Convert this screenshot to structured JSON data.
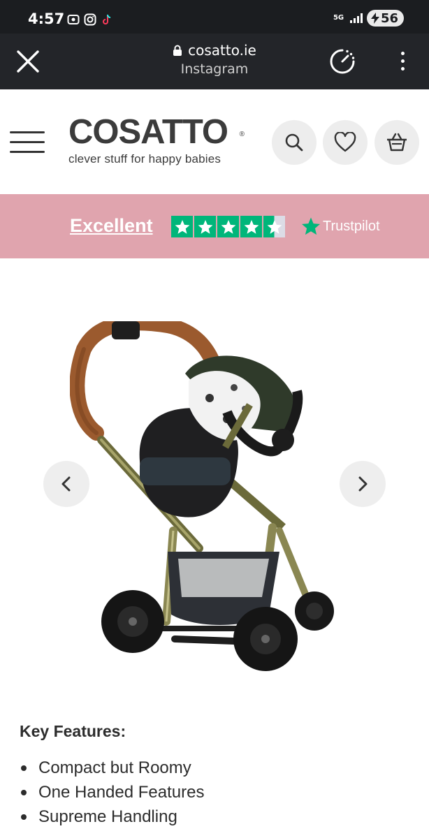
{
  "status_bar": {
    "time": "4:57",
    "network": "5G",
    "battery": "56"
  },
  "browser": {
    "url": "cosatto.ie",
    "subtitle": "Instagram"
  },
  "header": {
    "logo_text": "COSATTO",
    "logo_mark": "®",
    "tagline": "clever stuff for happy babies"
  },
  "trust": {
    "rating_text": "Excellent",
    "stars": 4.5,
    "brand": "Trustpilot",
    "color": "#00b67a"
  },
  "gallery": {
    "prev_icon": "chevron-left-icon",
    "next_icon": "chevron-right-icon"
  },
  "features": {
    "heading": "Key Features:",
    "items": [
      "Compact but Roomy",
      "One Handed Features",
      "Supreme Handling"
    ]
  },
  "colors": {
    "status_bg": "#1b1d20",
    "browser_bg": "#232529",
    "trust_bg": "#e0a4ae",
    "trustpilot_green": "#00b67a"
  }
}
